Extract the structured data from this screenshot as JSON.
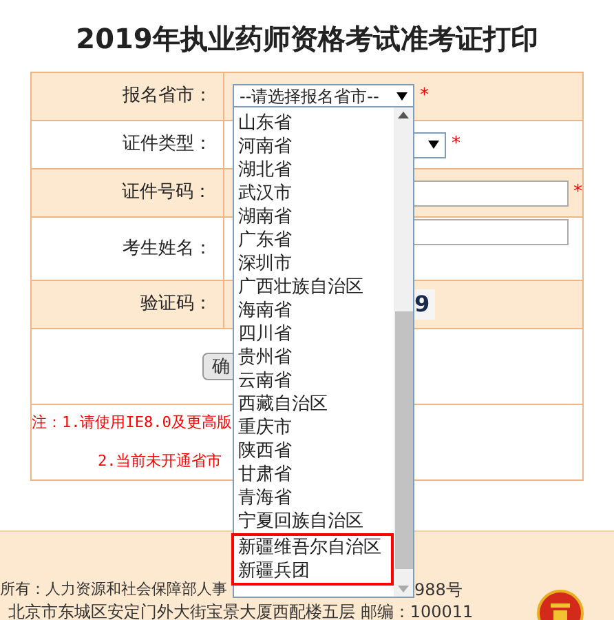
{
  "title": "2019年执业药师资格考试准考证打印",
  "form": {
    "rows": [
      {
        "label": "报名省市：",
        "kind": "select",
        "value": "--请选择报名省市--",
        "required_mark": "*"
      },
      {
        "label": "证件类型：",
        "kind": "select",
        "required_mark": "*"
      },
      {
        "label": "证件号码：",
        "kind": "input",
        "required_mark": "*"
      },
      {
        "label": "考生姓名：",
        "kind": "input"
      },
      {
        "label": "验证码：",
        "kind": "captcha",
        "captcha": "9"
      }
    ],
    "submit": "确"
  },
  "notes": [
    "注：1.请使用IE8.0及更高版",
    "2.当前未开通省市"
  ],
  "dropdown": {
    "options": [
      {
        "label": "山东省",
        "marked": false
      },
      {
        "label": "河南省",
        "marked": false
      },
      {
        "label": "湖北省",
        "marked": false
      },
      {
        "label": "武汉市",
        "marked": false
      },
      {
        "label": "湖南省",
        "marked": false
      },
      {
        "label": "广东省",
        "marked": false
      },
      {
        "label": "深圳市",
        "marked": false
      },
      {
        "label": "广西壮族自治区",
        "marked": false
      },
      {
        "label": "海南省",
        "marked": false
      },
      {
        "label": "四川省",
        "marked": false
      },
      {
        "label": "贵州省",
        "marked": false
      },
      {
        "label": "云南省",
        "marked": false
      },
      {
        "label": "西藏自治区",
        "marked": false
      },
      {
        "label": "重庆市",
        "marked": false
      },
      {
        "label": "陕西省",
        "marked": false
      },
      {
        "label": "甘肃省",
        "marked": false
      },
      {
        "label": "青海省",
        "marked": false
      },
      {
        "label": "宁夏回族自治区",
        "marked": false
      },
      {
        "label": "新疆维吾尔自治区",
        "marked": true
      },
      {
        "label": "新疆兵团",
        "marked": true
      }
    ]
  },
  "footer": {
    "line_1_left": "所有：人力资源和社会保障部人事",
    "line_1_right": "988号",
    "line_2": "北京市东城区安定门外大街宝景大厦西配楼五层 邮编：100011"
  }
}
